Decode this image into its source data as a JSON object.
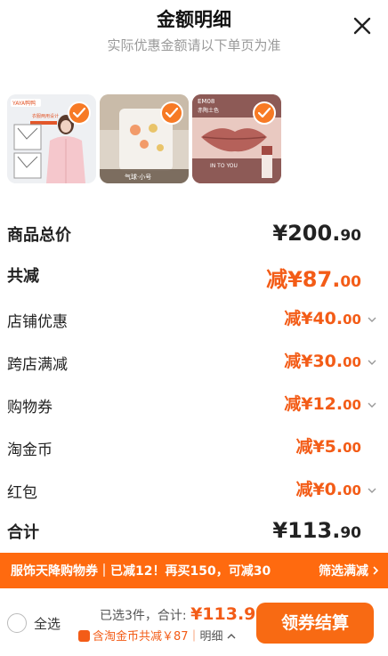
{
  "header": {
    "title": "金额明细",
    "subtitle": "实际优惠金额请以下单页为准"
  },
  "products": [
    {
      "brand_text": "YAYA鸭鸭",
      "caption": "衣服两用设计"
    },
    {
      "caption": "气球·小号"
    },
    {
      "code": "EM08",
      "shade": "赤陶土色",
      "tagline": "IN TO YOU"
    }
  ],
  "rows": [
    {
      "label": "商品总价",
      "main": "¥200.",
      "dec": "90"
    },
    {
      "label": "共减",
      "main": "减¥87.",
      "dec": "00"
    },
    {
      "label": "店铺优惠",
      "main": "减¥40.",
      "dec": "00"
    },
    {
      "label": "跨店满减",
      "main": "减¥30.",
      "dec": "00"
    },
    {
      "label": "购物券",
      "main": "减¥12.",
      "dec": "00"
    },
    {
      "label": "淘金币",
      "main": "减¥5.",
      "dec": "00"
    },
    {
      "label": "红包",
      "main": "减¥0.",
      "dec": "00"
    },
    {
      "label": "合计",
      "main": "¥113.",
      "dec": "90"
    }
  ],
  "promo": {
    "text": "服饰天降购物券｜已减12！再买150，可减30",
    "filter": "筛选满减"
  },
  "bottom": {
    "select_all": "全选",
    "summary_prefix": "已选3件，合计: ",
    "total": "¥113.90",
    "subline": "含淘金币共减￥87｜",
    "detail": "明细",
    "checkout": "领券结算"
  },
  "colors": {
    "accent": "#f35c17",
    "promo_bg": "#ff6a0f",
    "checkout_bg": "#f86a13"
  }
}
